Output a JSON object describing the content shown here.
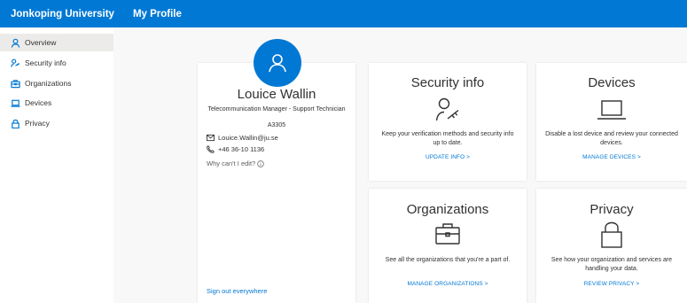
{
  "topbar": {
    "org": "Jonkoping University",
    "app": "My Profile"
  },
  "sidebar": {
    "items": [
      {
        "label": "Overview",
        "icon": "person-icon",
        "active": true
      },
      {
        "label": "Security info",
        "icon": "security-key-icon"
      },
      {
        "label": "Organizations",
        "icon": "briefcase-icon"
      },
      {
        "label": "Devices",
        "icon": "laptop-icon"
      },
      {
        "label": "Privacy",
        "icon": "lock-icon"
      }
    ]
  },
  "profile": {
    "name": "Louice Wallin",
    "title": "Telecommunication Manager - Support Technician",
    "code": "A3305",
    "email": "Louice.Wallin@ju.se",
    "phone": "+46 36-10 1136",
    "why_edit": "Why can't I edit?",
    "sign_out": "Sign out everywhere"
  },
  "tiles": {
    "security": {
      "title": "Security info",
      "desc": "Keep your verification methods and security info up to date.",
      "link": "UPDATE INFO >"
    },
    "devices": {
      "title": "Devices",
      "desc": "Disable a lost device and review your connected devices.",
      "link": "MANAGE DEVICES >"
    },
    "organizations": {
      "title": "Organizations",
      "desc": "See all the organizations that you're a part of.",
      "link": "MANAGE ORGANIZATIONS >"
    },
    "privacy": {
      "title": "Privacy",
      "desc": "See how your organization and services are handling your data.",
      "link": "REVIEW PRIVACY >"
    }
  },
  "colors": {
    "accent": "#0078d4",
    "background": "#f8f8f8",
    "text": "#323130"
  }
}
